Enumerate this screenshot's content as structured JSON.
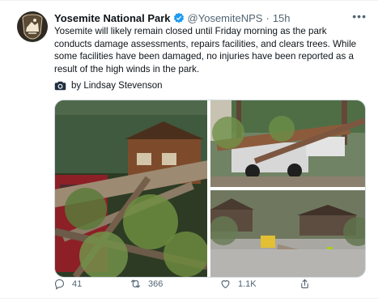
{
  "tweet": {
    "author_name": "Yosemite National Park",
    "handle": "@YosemiteNPS",
    "separator": "·",
    "time": "15h",
    "more_icon": "more-icon",
    "body": "Yosemite will likely remain closed until Friday morning as the park conducts damage assessments, repairs facilities, and clears trees. While some facilities have been damaged, no injuries have been reported as a result of the high winds in the park.",
    "credit": "by Lindsay Stevenson",
    "actions": {
      "replies": "41",
      "retweets": "366",
      "likes": "1.1K"
    }
  }
}
